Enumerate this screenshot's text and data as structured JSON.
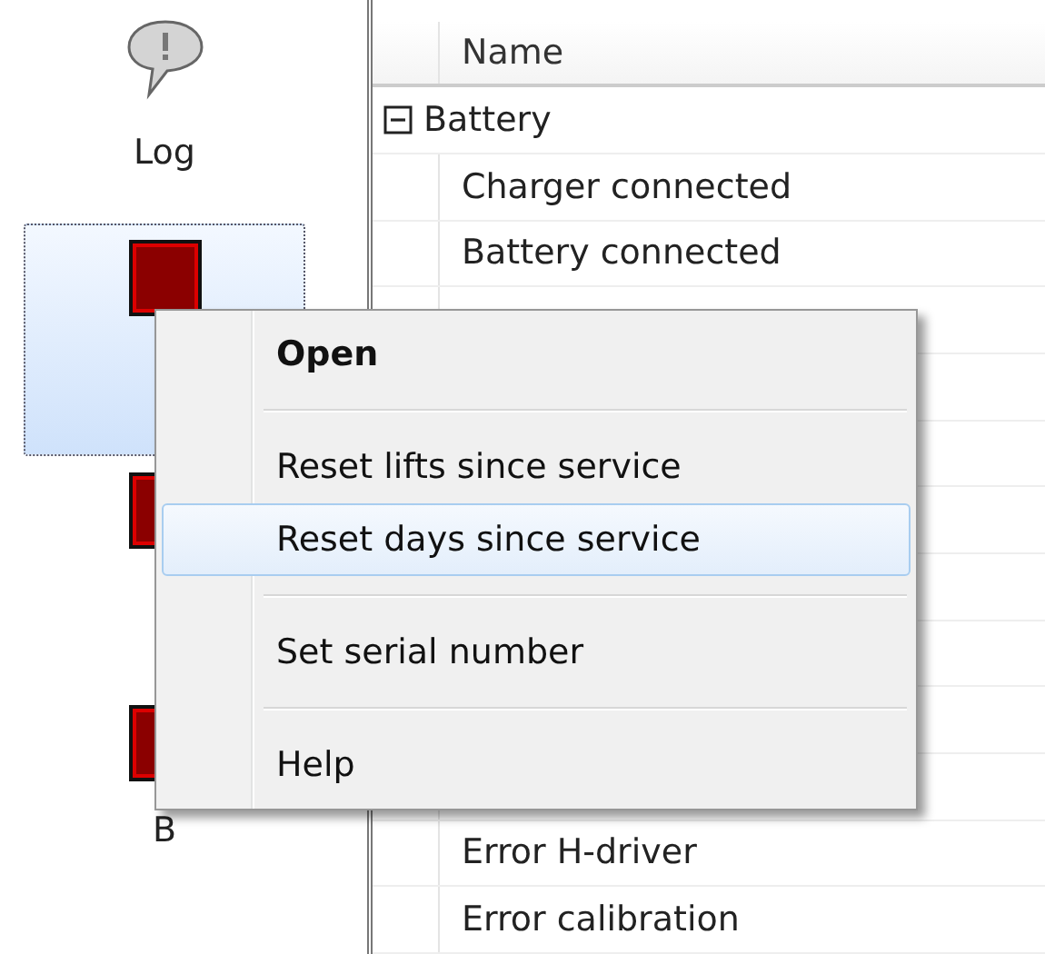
{
  "sidebar": {
    "items": [
      {
        "kind": "log",
        "label": "Log",
        "selected": false
      },
      {
        "kind": "status",
        "selected": true
      },
      {
        "kind": "status",
        "selected": false
      },
      {
        "kind": "status",
        "label": "B",
        "selected": false
      }
    ]
  },
  "table": {
    "columns": [
      "Name"
    ],
    "groups": [
      {
        "name": "Battery",
        "expanded": true,
        "rows": [
          {
            "kind": "text",
            "name": "Charger connected"
          },
          {
            "kind": "text",
            "name": "Battery connected"
          },
          {
            "kind": "covered"
          },
          {
            "kind": "covered"
          },
          {
            "kind": "covered"
          },
          {
            "kind": "covered"
          },
          {
            "kind": "covered"
          },
          {
            "kind": "covered"
          },
          {
            "kind": "covered"
          },
          {
            "kind": "covered"
          },
          {
            "kind": "text",
            "name": "Error H-driver"
          },
          {
            "kind": "text",
            "name": "Error calibration"
          }
        ]
      }
    ]
  },
  "context_menu": {
    "items": [
      {
        "kind": "default",
        "label": "Open",
        "selected": false
      },
      {
        "kind": "separator"
      },
      {
        "kind": "item",
        "label": "Reset lifts since service",
        "selected": false
      },
      {
        "kind": "item",
        "label": "Reset days since service",
        "selected": true
      },
      {
        "kind": "separator"
      },
      {
        "kind": "item",
        "label": "Set serial number",
        "selected": false
      },
      {
        "kind": "separator"
      },
      {
        "kind": "item",
        "label": "Help",
        "selected": false
      }
    ]
  }
}
